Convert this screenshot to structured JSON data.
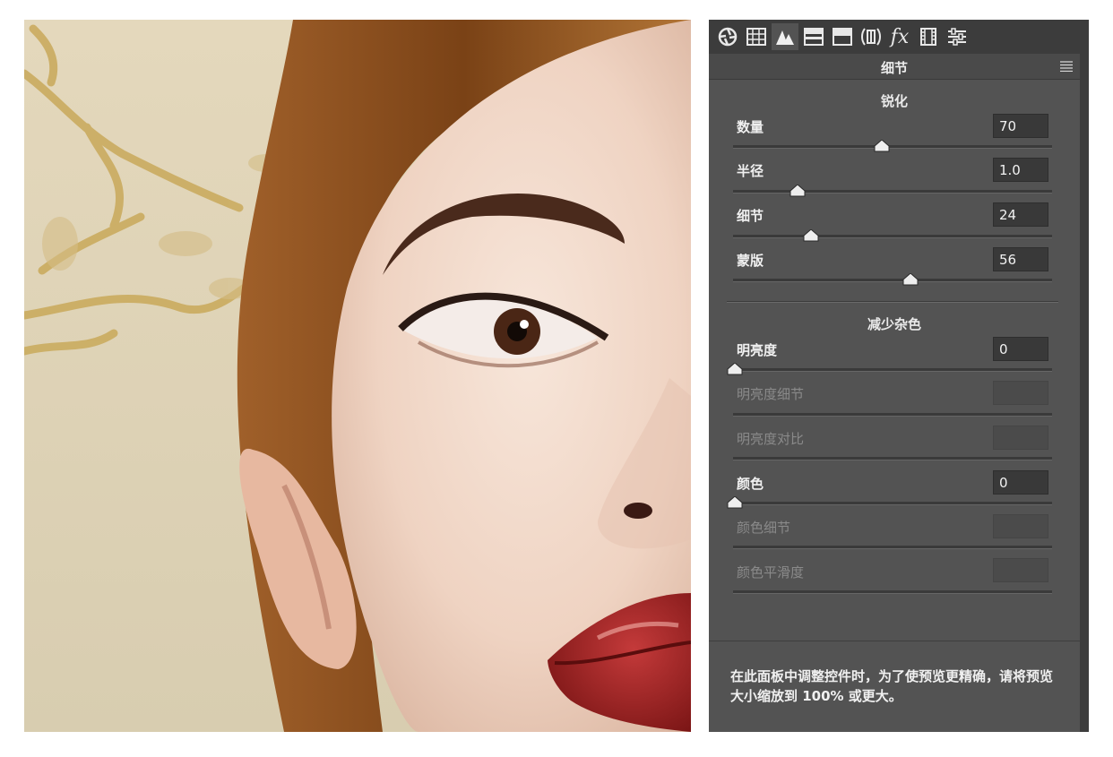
{
  "panel": {
    "title": "细节",
    "tabs": [
      "basic-tab",
      "tone-curve-tab",
      "detail-tab",
      "hsl-tab",
      "split-toning-tab",
      "lens-corrections-tab",
      "effects-tab",
      "camera-calibration-tab",
      "presets-tab"
    ],
    "effects_label": "fx",
    "sharpening": {
      "title": "锐化",
      "amount": {
        "label": "数量",
        "value": "70",
        "level": 0.47
      },
      "radius": {
        "label": "半径",
        "value": "1.0",
        "level": 0.2
      },
      "detail": {
        "label": "细节",
        "value": "24",
        "level": 0.24
      },
      "masking": {
        "label": "蒙版",
        "value": "56",
        "level": 0.56
      }
    },
    "noise_reduction": {
      "title": "减少杂色",
      "luminance": {
        "label": "明亮度",
        "value": "0",
        "level": 0
      },
      "luminance_detail": {
        "label": "明亮度细节",
        "value": ""
      },
      "luminance_contrast": {
        "label": "明亮度对比",
        "value": ""
      },
      "color": {
        "label": "颜色",
        "value": "0",
        "level": 0
      },
      "color_detail": {
        "label": "颜色细节",
        "value": ""
      },
      "color_smoothness": {
        "label": "颜色平滑度",
        "value": ""
      }
    },
    "note": "在此面板中调整控件时，为了使预览更精确，请将预览大小缩放到 100% 或更大。"
  },
  "colors": {
    "panel_bg": "#535353",
    "toolbar_bg": "#3c3c3c",
    "text": "#f0f0f0",
    "disabled_text": "#8a8a8a"
  }
}
